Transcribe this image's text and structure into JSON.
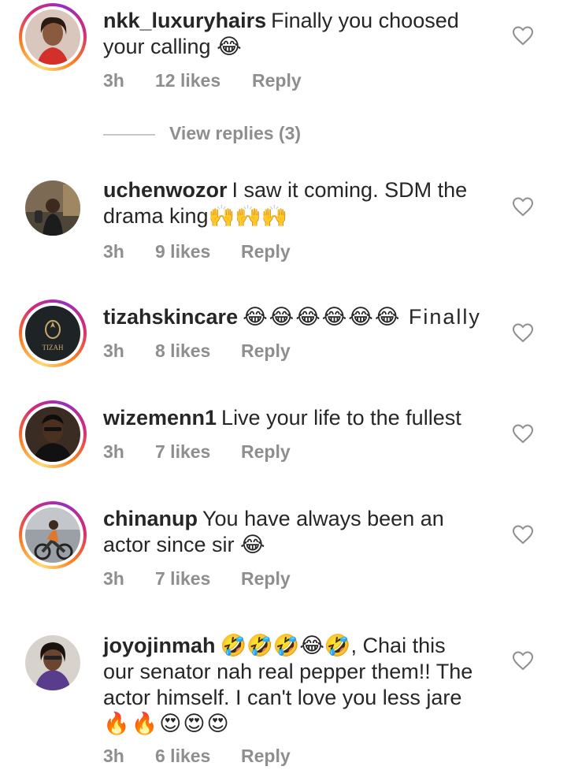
{
  "comments": [
    {
      "username": "nkk_luxuryhairs",
      "text_line1": "Finally you choosed",
      "text_line2": "your calling 😂",
      "time": "3h",
      "likes": "12 likes",
      "reply": "Reply"
    },
    {
      "username": "uchenwozor",
      "text_line1": "I saw it coming. SDM the",
      "text_line2": "drama king🙌🙌🙌",
      "time": "3h",
      "likes": "9 likes",
      "reply": "Reply"
    },
    {
      "username": "tizahskincare",
      "text_line1": "😂😂😂😂😂😂 Finally",
      "time": "3h",
      "likes": "8 likes",
      "reply": "Reply"
    },
    {
      "username": "wizemenn1",
      "text_line1": "Live your life to the fullest",
      "time": "3h",
      "likes": "7 likes",
      "reply": "Reply"
    },
    {
      "username": "chinanup",
      "text_line1": "You have always been an",
      "text_line2": "actor since sir 😂",
      "time": "3h",
      "likes": "7 likes",
      "reply": "Reply"
    },
    {
      "username": "joyojinmah",
      "text_line1": "🤣🤣🤣😂🤣, Chai this",
      "text_line2": "our senator nah real pepper them!! The",
      "text_line3": "actor himself. I can't love you less jare",
      "text_line4": "🔥🔥😍😍😍",
      "time": "3h",
      "likes": "6 likes",
      "reply": "Reply"
    }
  ],
  "view_replies": "View replies (3)",
  "avatar_brand_text": "TIZAH",
  "colors": {
    "text": "#262626",
    "secondary": "#8e8e8e",
    "divider": "#c7c7c7",
    "story_ring": [
      "#feda75",
      "#fa7e1e",
      "#d62976",
      "#962fbf"
    ]
  },
  "icons": {
    "like": "heart-outline-icon"
  }
}
